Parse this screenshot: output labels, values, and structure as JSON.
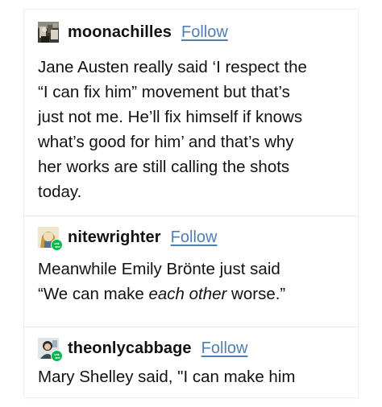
{
  "posts": [
    {
      "username": "moonachilles",
      "follow_label": "Follow",
      "avatar_icon": "avatar-image-icon",
      "reblogged": false,
      "lines": [
        "Jane Austen really said ‘I respect the",
        "“I can fix him” movement but that’s",
        "just not me. He’ll fix himself if knows",
        "what’s good for him’ and that’s why",
        "her works are still calling the shots",
        "today."
      ]
    },
    {
      "username": "nitewrighter",
      "follow_label": "Follow",
      "avatar_icon": "avatar-image-icon",
      "reblogged": true,
      "line1": "Meanwhile Emily Brönte just said",
      "line2_before": "“We can make ",
      "line2_em": "each other",
      "line2_after": " worse.”"
    },
    {
      "username": "theonlycabbage",
      "follow_label": "Follow",
      "avatar_icon": "avatar-image-icon",
      "reblogged": true,
      "lines": [
        "Mary Shelley said, \"I can make him"
      ]
    }
  ],
  "colors": {
    "follow_link": "#4f7fb3",
    "reblog_badge": "#00b94a",
    "text": "#111111"
  }
}
